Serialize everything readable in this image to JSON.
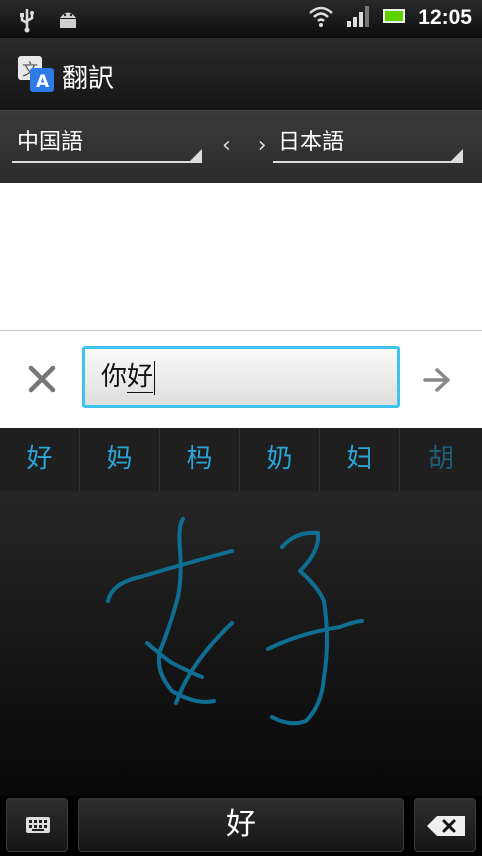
{
  "status_bar": {
    "time": "12:05",
    "icons": [
      "usb-icon",
      "android-debug-icon",
      "wifi-icon",
      "signal-icon",
      "battery-icon"
    ]
  },
  "app": {
    "title": "翻訳"
  },
  "languages": {
    "source": "中国語",
    "target": "日本語",
    "swap_symbol": "‹ ›"
  },
  "input": {
    "text_plain": "你",
    "text_composing": "好"
  },
  "candidates": [
    "好",
    "妈",
    "杩",
    "奶",
    "妇",
    "胡"
  ],
  "keyboard": {
    "space_candidate": "好"
  },
  "colors": {
    "accent": "#3fc3ee",
    "candidate_text": "#2aa7d8",
    "ink": "#0e6f93"
  }
}
